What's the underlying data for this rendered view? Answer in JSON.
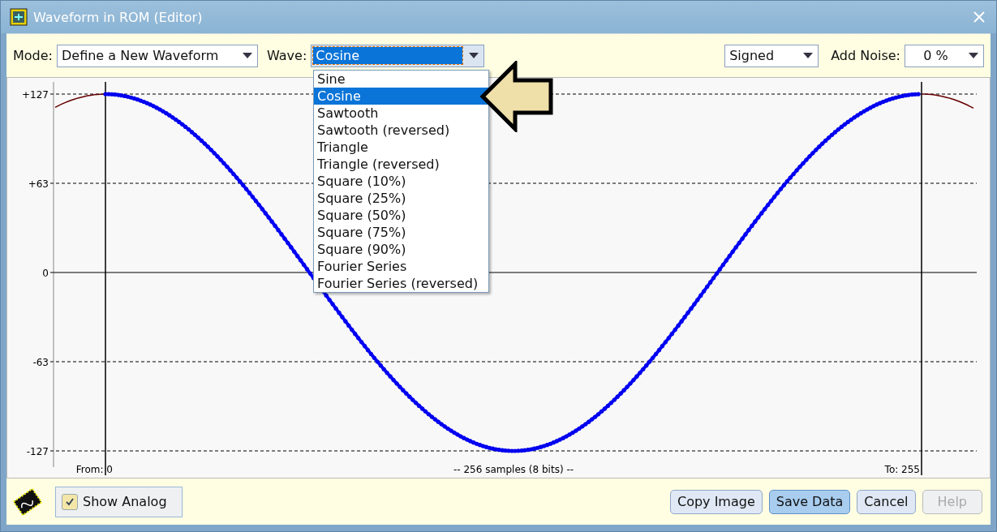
{
  "window": {
    "title": "Waveform in ROM (Editor)"
  },
  "toolbar": {
    "mode": {
      "label": "Mode:",
      "value": "Define a New Waveform"
    },
    "wave": {
      "label": "Wave:",
      "value": "Cosine",
      "expanded": true
    },
    "format": {
      "value": "Signed"
    },
    "noise": {
      "label": "Add Noise:",
      "value": "0 %"
    }
  },
  "wave_options": [
    {
      "label": "Sine",
      "selected": false
    },
    {
      "label": "Cosine",
      "selected": true
    },
    {
      "label": "Sawtooth",
      "selected": false
    },
    {
      "label": "Sawtooth (reversed)",
      "selected": false
    },
    {
      "label": "Triangle",
      "selected": false
    },
    {
      "label": "Triangle (reversed)",
      "selected": false
    },
    {
      "label": "Square (10%)",
      "selected": false
    },
    {
      "label": "Square (25%)",
      "selected": false
    },
    {
      "label": "Square (50%)",
      "selected": false
    },
    {
      "label": "Square (75%)",
      "selected": false
    },
    {
      "label": "Square (90%)",
      "selected": false
    },
    {
      "label": "Fourier Series",
      "selected": false
    },
    {
      "label": "Fourier Series (reversed)",
      "selected": false
    }
  ],
  "plot": {
    "y_ticks": [
      "+127",
      "+63",
      "0",
      "-63",
      "-127"
    ],
    "from_label": "From: 0",
    "caption": "-- 256 samples (8 bits) --",
    "to_label": "To: 255"
  },
  "footer": {
    "show_analog": {
      "label": "Show Analog",
      "checked": true
    },
    "buttons": [
      {
        "label": "Copy Image",
        "kind": "normal"
      },
      {
        "label": "Save Data",
        "kind": "default"
      },
      {
        "label": "Cancel",
        "kind": "normal"
      },
      {
        "label": "Help",
        "kind": "disabled"
      }
    ]
  }
}
